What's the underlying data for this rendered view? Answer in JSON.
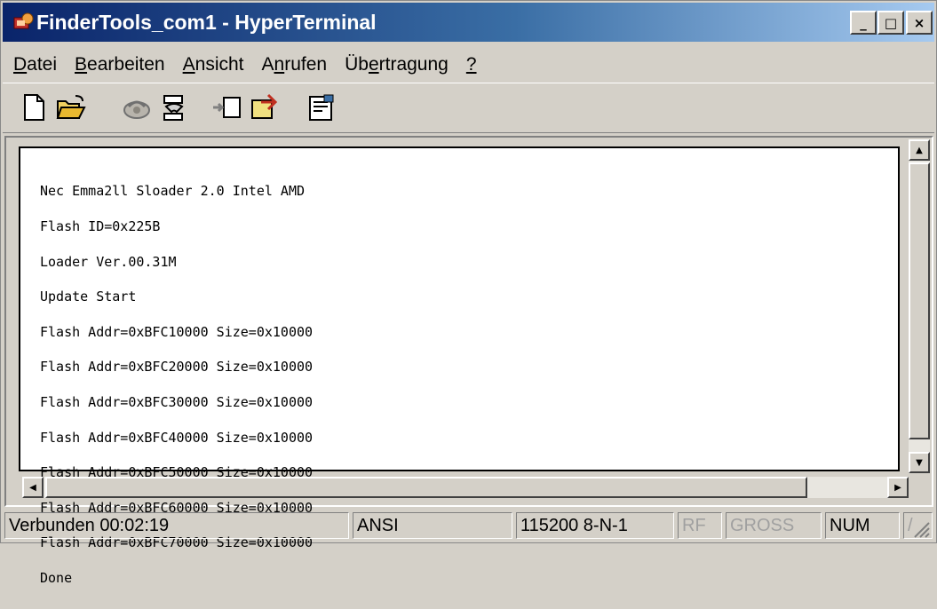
{
  "window": {
    "title": "FinderTools_com1 - HyperTerminal",
    "controls": {
      "minimize": "_",
      "maximize": "□",
      "close": "×"
    }
  },
  "menu": [
    {
      "mnemonic": "D",
      "rest": "atei"
    },
    {
      "mnemonic": "B",
      "rest": "earbeiten"
    },
    {
      "mnemonic": "A",
      "rest": "nsicht"
    },
    {
      "pre": "A",
      "mnemonic": "n",
      "rest": "rufen"
    },
    {
      "pre": "Üb",
      "mnemonic": "e",
      "rest": "rtragung"
    },
    {
      "mnemonic": "?",
      "rest": ""
    }
  ],
  "toolbar": {
    "icons": [
      "new-icon",
      "open-icon",
      "connect-icon",
      "disconnect-icon",
      "send-icon",
      "receive-icon",
      "properties-icon"
    ]
  },
  "terminal": {
    "lines": [
      "Nec Emma2ll Sloader 2.0 Intel AMD",
      "Flash ID=0x225B",
      "Loader Ver.00.31M",
      "Update Start",
      "Flash Addr=0xBFC10000 Size=0x10000",
      "Flash Addr=0xBFC20000 Size=0x10000",
      "Flash Addr=0xBFC30000 Size=0x10000",
      "Flash Addr=0xBFC40000 Size=0x10000",
      "Flash Addr=0xBFC50000 Size=0x10000",
      "Flash Addr=0xBFC60000 Size=0x10000",
      "Flash Addr=0xBFC70000 Size=0x10000",
      "Done"
    ]
  },
  "status": {
    "connection": "Verbunden 00:02:19",
    "emulation": "ANSI",
    "port_settings": "115200 8-N-1",
    "rf": "RF",
    "gross": "GROSS",
    "num": "NUM",
    "extra": "/"
  },
  "colors": {
    "title_gradient_start": "#0a246a",
    "title_gradient_end": "#a6caf0",
    "chrome": "#d4d0c8",
    "terminal_bg": "#ffffff"
  }
}
